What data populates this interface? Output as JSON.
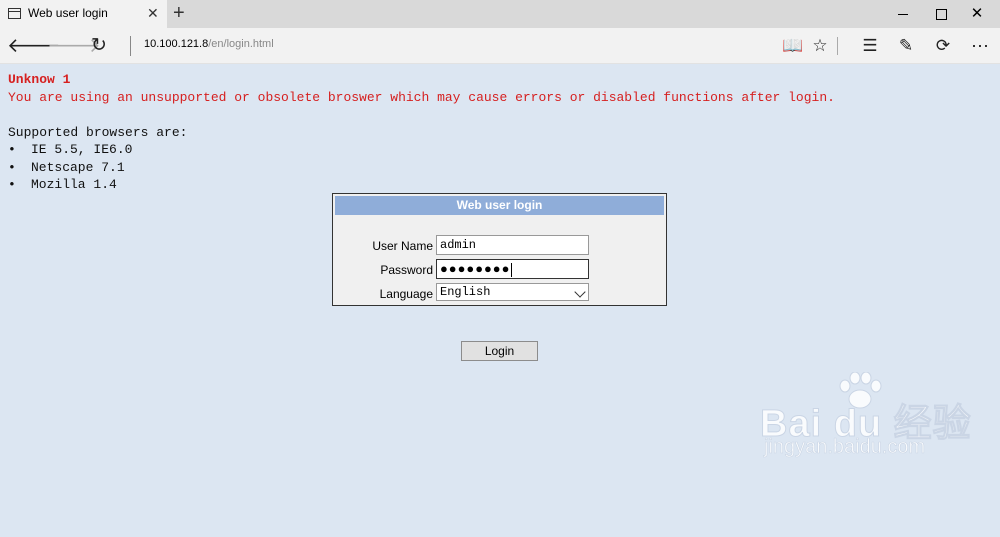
{
  "window": {
    "tab_title": "Web user login",
    "new_tab_label": "+",
    "minimize_icon": "minimize-icon",
    "maximize_icon": "maximize-icon",
    "close_glyph": "✕"
  },
  "address_bar": {
    "url_host": "10.100.121.8",
    "url_path": "/en/login.html",
    "icons": [
      "back-arrow-icon",
      "forward-arrow-icon",
      "refresh-icon",
      "reading-view-icon",
      "favorite-star-icon",
      "hub-icon",
      "web-note-icon",
      "share-icon",
      "more-icon"
    ]
  },
  "page": {
    "warning_title": "Unknow 1",
    "warning_message": "You are using an unsupported or obsolete broswer which may cause errors or disabled functions after login.",
    "supported_heading": "Supported browsers are:",
    "bullet_glyph": "•",
    "browsers": [
      "IE 5.5, IE6.0",
      "Netscape 7.1",
      "Mozilla 1.4"
    ]
  },
  "login_form": {
    "header": "Web user login",
    "username_label": "User Name",
    "username_value": "admin",
    "password_label": "Password",
    "password_mask": "●●●●●●●●",
    "language_label": "Language",
    "language_selected": "English",
    "login_button": "Login"
  },
  "watermark": {
    "brand": "Bai du 经验",
    "site": "jingyan.baidu.com"
  },
  "colors": {
    "page_background": "#dce6f2",
    "warning_red": "#d62020",
    "login_header_blue": "#8fadd9"
  }
}
